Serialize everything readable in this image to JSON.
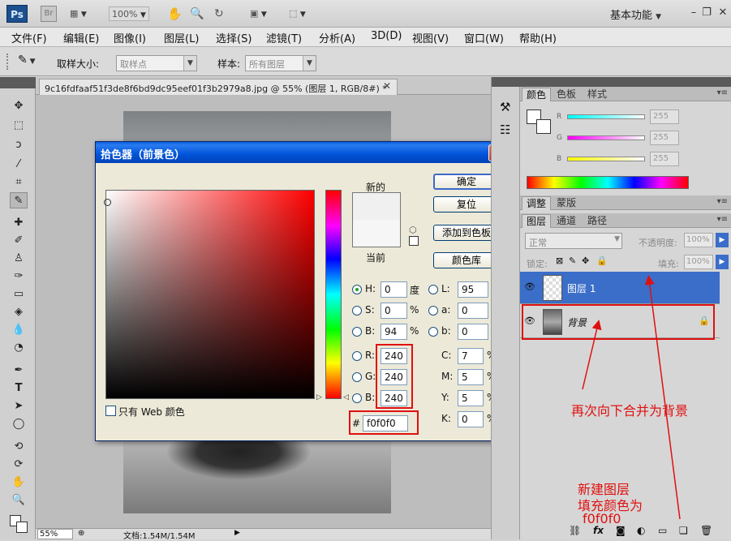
{
  "app": {
    "logo": "Ps",
    "bridge": "Br",
    "zoom": "100%",
    "workspace": "基本功能"
  },
  "menu": [
    "文件(F)",
    "编辑(E)",
    "图像(I)",
    "图层(L)",
    "选择(S)",
    "滤镜(T)",
    "分析(A)",
    "3D(D)",
    "视图(V)",
    "窗口(W)",
    "帮助(H)"
  ],
  "options": {
    "sample_size_label": "取样大小:",
    "sample_size_value": "取样点",
    "sample_label": "样本:",
    "sample_value": "所有图层"
  },
  "document": {
    "tab_title": "9c16fdfaaf51f3de8f6bd9dc95eef01f3b2979a8.jpg @ 55% (图层 1, RGB/8#) *",
    "zoom": "55%",
    "doc_info": "文档:1.54M/1.54M"
  },
  "dialog": {
    "title": "拾色器（前景色）",
    "new_label": "新的",
    "current_label": "当前",
    "buttons": {
      "ok": "确定",
      "reset": "复位",
      "add_swatch": "添加到色板",
      "libraries": "颜色库"
    },
    "web_only_label": "只有 Web 颜色",
    "fields": {
      "H": "0",
      "S": "0",
      "B": "94",
      "R": "240",
      "G": "240",
      "Bl": "240",
      "L": "95",
      "a": "0",
      "b": "0",
      "C": "7",
      "M": "5",
      "Y": "5",
      "K": "0",
      "hex": "f0f0f0"
    },
    "units": {
      "deg": "度",
      "pct": "%"
    },
    "labels": {
      "H": "H:",
      "S": "S:",
      "B": "B:",
      "R": "R:",
      "G": "G:",
      "Bl": "B:",
      "L": "L:",
      "a": "a:",
      "b": "b:",
      "C": "C:",
      "M": "M:",
      "Y": "Y:",
      "K": "K:",
      "hash": "#"
    },
    "new_color": "#f0f0f0",
    "current_color": "#f6f6f6"
  },
  "color_panel": {
    "tabs": [
      "颜色",
      "色板",
      "样式"
    ],
    "R": "255",
    "G": "255",
    "B": "255"
  },
  "adjust_panel": {
    "tabs": [
      "调整",
      "蒙版"
    ]
  },
  "layers_panel": {
    "tabs": [
      "图层",
      "通道",
      "路径"
    ],
    "blend_mode": "正常",
    "opacity_label": "不透明度:",
    "opacity": "100%",
    "lock_label": "锁定:",
    "fill_label": "填充:",
    "fill": "100%",
    "layers": [
      {
        "name": "图层 1",
        "selected": true
      },
      {
        "name": "背景",
        "locked": true
      }
    ]
  },
  "annotations": {
    "merge_text": "再次向下合并为背景",
    "new_layer_text_1": "新建图层",
    "new_layer_text_2": "填充颜色为",
    "new_layer_text_3": "f0f0f0"
  },
  "colors": {
    "accent": "#e01010",
    "dialog_title": "#0052d8",
    "selected_layer": "#3a6ec9"
  }
}
